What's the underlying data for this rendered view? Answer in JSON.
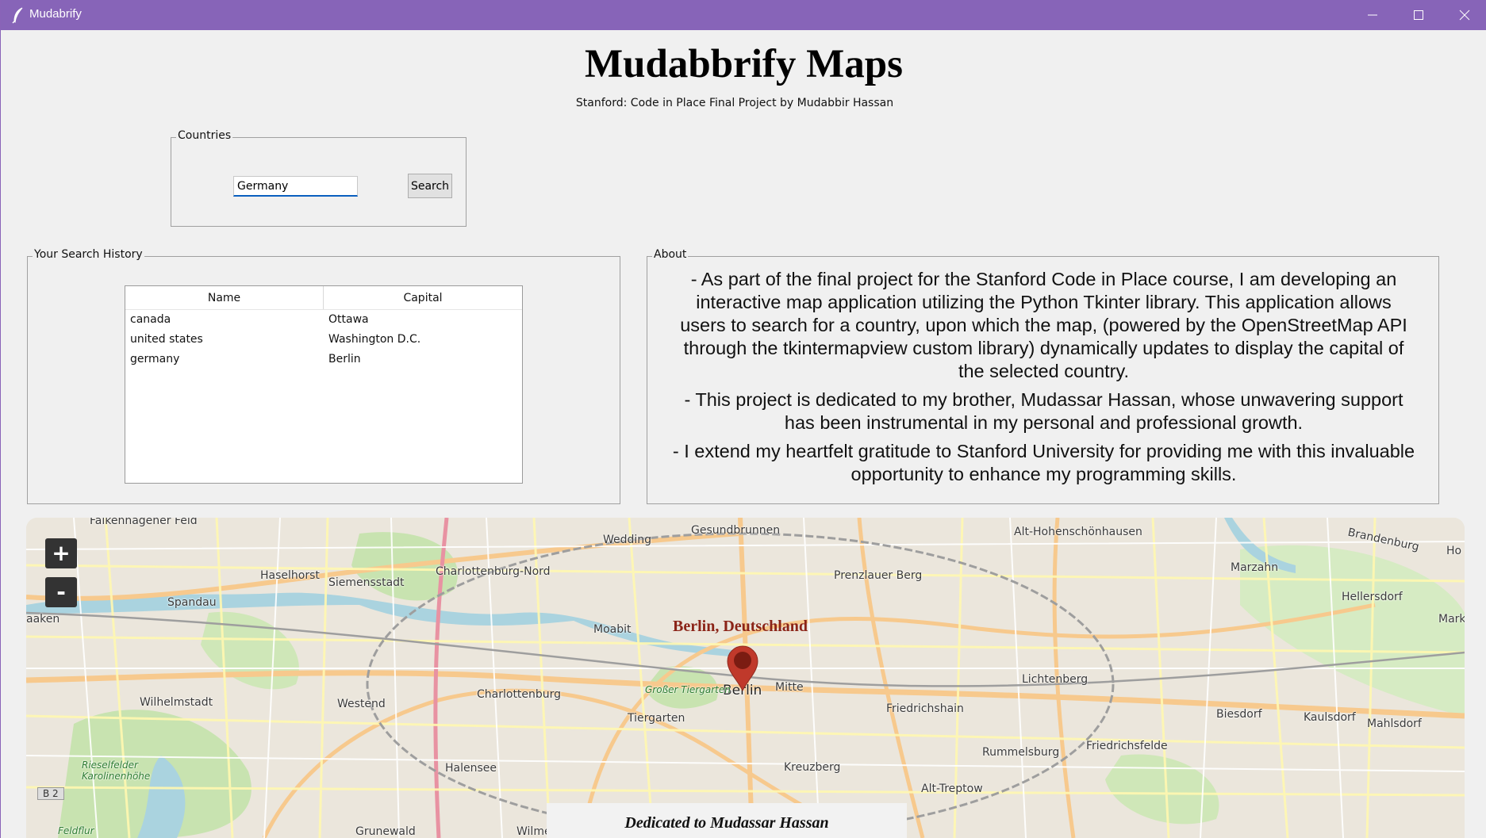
{
  "window": {
    "title": "Mudabrify",
    "icon": "feather-icon",
    "controls": [
      "minimize-icon",
      "maximize-icon",
      "close-icon"
    ]
  },
  "header": {
    "title": "Mudabbrify Maps",
    "subtitle": "Stanford: Code in Place Final Project by Mudabbir Hassan"
  },
  "countries": {
    "legend": "Countries",
    "search_value": "Germany",
    "search_button": "Search"
  },
  "history": {
    "legend": "Your Search History",
    "columns": [
      "Name",
      "Capital"
    ],
    "rows": [
      {
        "name": "canada",
        "capital": "Ottawa"
      },
      {
        "name": "united states",
        "capital": "Washington D.C."
      },
      {
        "name": "germany",
        "capital": "Berlin"
      }
    ]
  },
  "about": {
    "legend": "About",
    "paragraphs": [
      "- As part of the final project for the Stanford Code in Place course, I am developing an interactive map application utilizing the Python Tkinter library. This application allows users to search for a country, upon which the map, (powered by the OpenStreetMap API through the tkintermapview custom library) dynamically updates to display the capital of the selected country.",
      "- This project is dedicated to my brother, Mudassar Hassan, whose unwavering support has been instrumental in my personal and professional growth.",
      "- I extend my heartfelt gratitude to Stanford University for providing me with this invaluable opportunity to enhance my programming skills."
    ]
  },
  "map": {
    "zoom_in": "+",
    "zoom_out": "-",
    "marker_label": "Berlin, Deutschland",
    "dedication": "Dedicated to Mudassar Hassan",
    "road_badge": "B 2",
    "places": [
      "Falkenhagener Feld",
      "Spandau",
      "Haselhorst",
      "Siemensstadt",
      "Charlottenburg-Nord",
      "Wedding",
      "Gesundbrunnen",
      "Prenzlauer Berg",
      "Alt-Hohenschönhausen",
      "Marzahn",
      "Hellersdorf",
      "Moabit",
      "Berlin",
      "Mitte",
      "Lichtenberg",
      "Wilhelmstadt",
      "Westend",
      "Charlottenburg",
      "Tiergarten",
      "Großer Tiergarten",
      "Friedrichshain",
      "Biesdorf",
      "Kaulsdorf",
      "Mahlsdorf",
      "Rummelsburg",
      "Friedrichsfelde",
      "Halensee",
      "Kreuzberg",
      "Alt-Treptow",
      "Grunewald",
      "Wilme",
      "Rieselfelder Karolinenhöhe",
      "Feldflur",
      "aaken",
      "Brandenburg",
      "Ho",
      "Marki",
      "Berlin"
    ],
    "colors": {
      "marker": "#c0392b",
      "marker_dark": "#7b1c12",
      "park": "#c8e3b0",
      "water": "#aad3df",
      "road_major": "#f7c98d",
      "road_minor": "#fff7b0",
      "rail": "#9e9e9e"
    }
  }
}
